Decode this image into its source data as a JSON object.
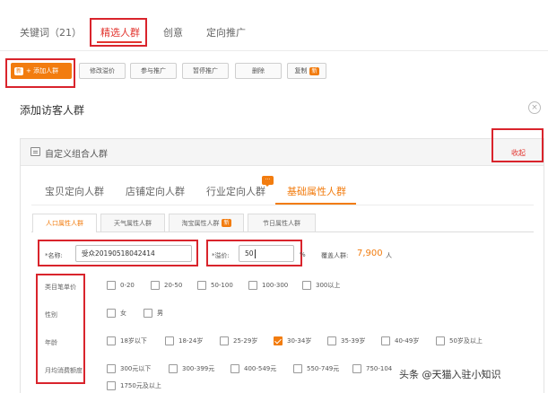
{
  "top_tabs": [
    "关键词（21）",
    "精选人群",
    "创意",
    "定向推广"
  ],
  "toolbar": {
    "add_badge": "新",
    "add_label": "+ 添加人群",
    "buttons": [
      "修改溢价",
      "参与推广",
      "暂停推广",
      "删除",
      "复制"
    ],
    "copy_badge": "新"
  },
  "section_title": "添加访客人群",
  "close_glyph": "×",
  "panel": {
    "title": "自定义组合人群",
    "collapse": "收起"
  },
  "category_tabs": [
    "宝贝定向人群",
    "店铺定向人群",
    "行业定向人群",
    "基础属性人群"
  ],
  "chat_glyph": "···",
  "sub_tabs": [
    "人口属性人群",
    "天气属性人群",
    "淘宝属性人群",
    "节日属性人群"
  ],
  "sub_tab_badge": "新",
  "form": {
    "name_label": "*名称:",
    "name_value": "受众20190518042414",
    "premium_label": "*溢价:",
    "premium_value": "50",
    "percent": "%",
    "coverage_label": "覆盖人群:",
    "coverage_value": "7,900",
    "coverage_unit": "人"
  },
  "attributes": {
    "price_label": "类目笔单价",
    "price_options": [
      "0-20",
      "20-50",
      "50-100",
      "100-300",
      "300以上"
    ],
    "gender_label": "性别",
    "gender_options": [
      "女",
      "男"
    ],
    "age_label": "年龄",
    "age_options": [
      "18岁以下",
      "18-24岁",
      "25-29岁",
      "30-34岁",
      "35-39岁",
      "40-49岁",
      "50岁及以上"
    ],
    "age_checked": "30-34岁",
    "spend_label": "月均消费额度",
    "spend_options": [
      "300元以下",
      "300-399元",
      "400-549元",
      "550-749元",
      "750-104"
    ],
    "spend_extra": "1750元及以上"
  },
  "watermark": "头条 @天猫入驻小知识",
  "colors": {
    "accent": "#f27c0f",
    "highlight": "#d9242c",
    "tab_active": "#e2352f"
  }
}
